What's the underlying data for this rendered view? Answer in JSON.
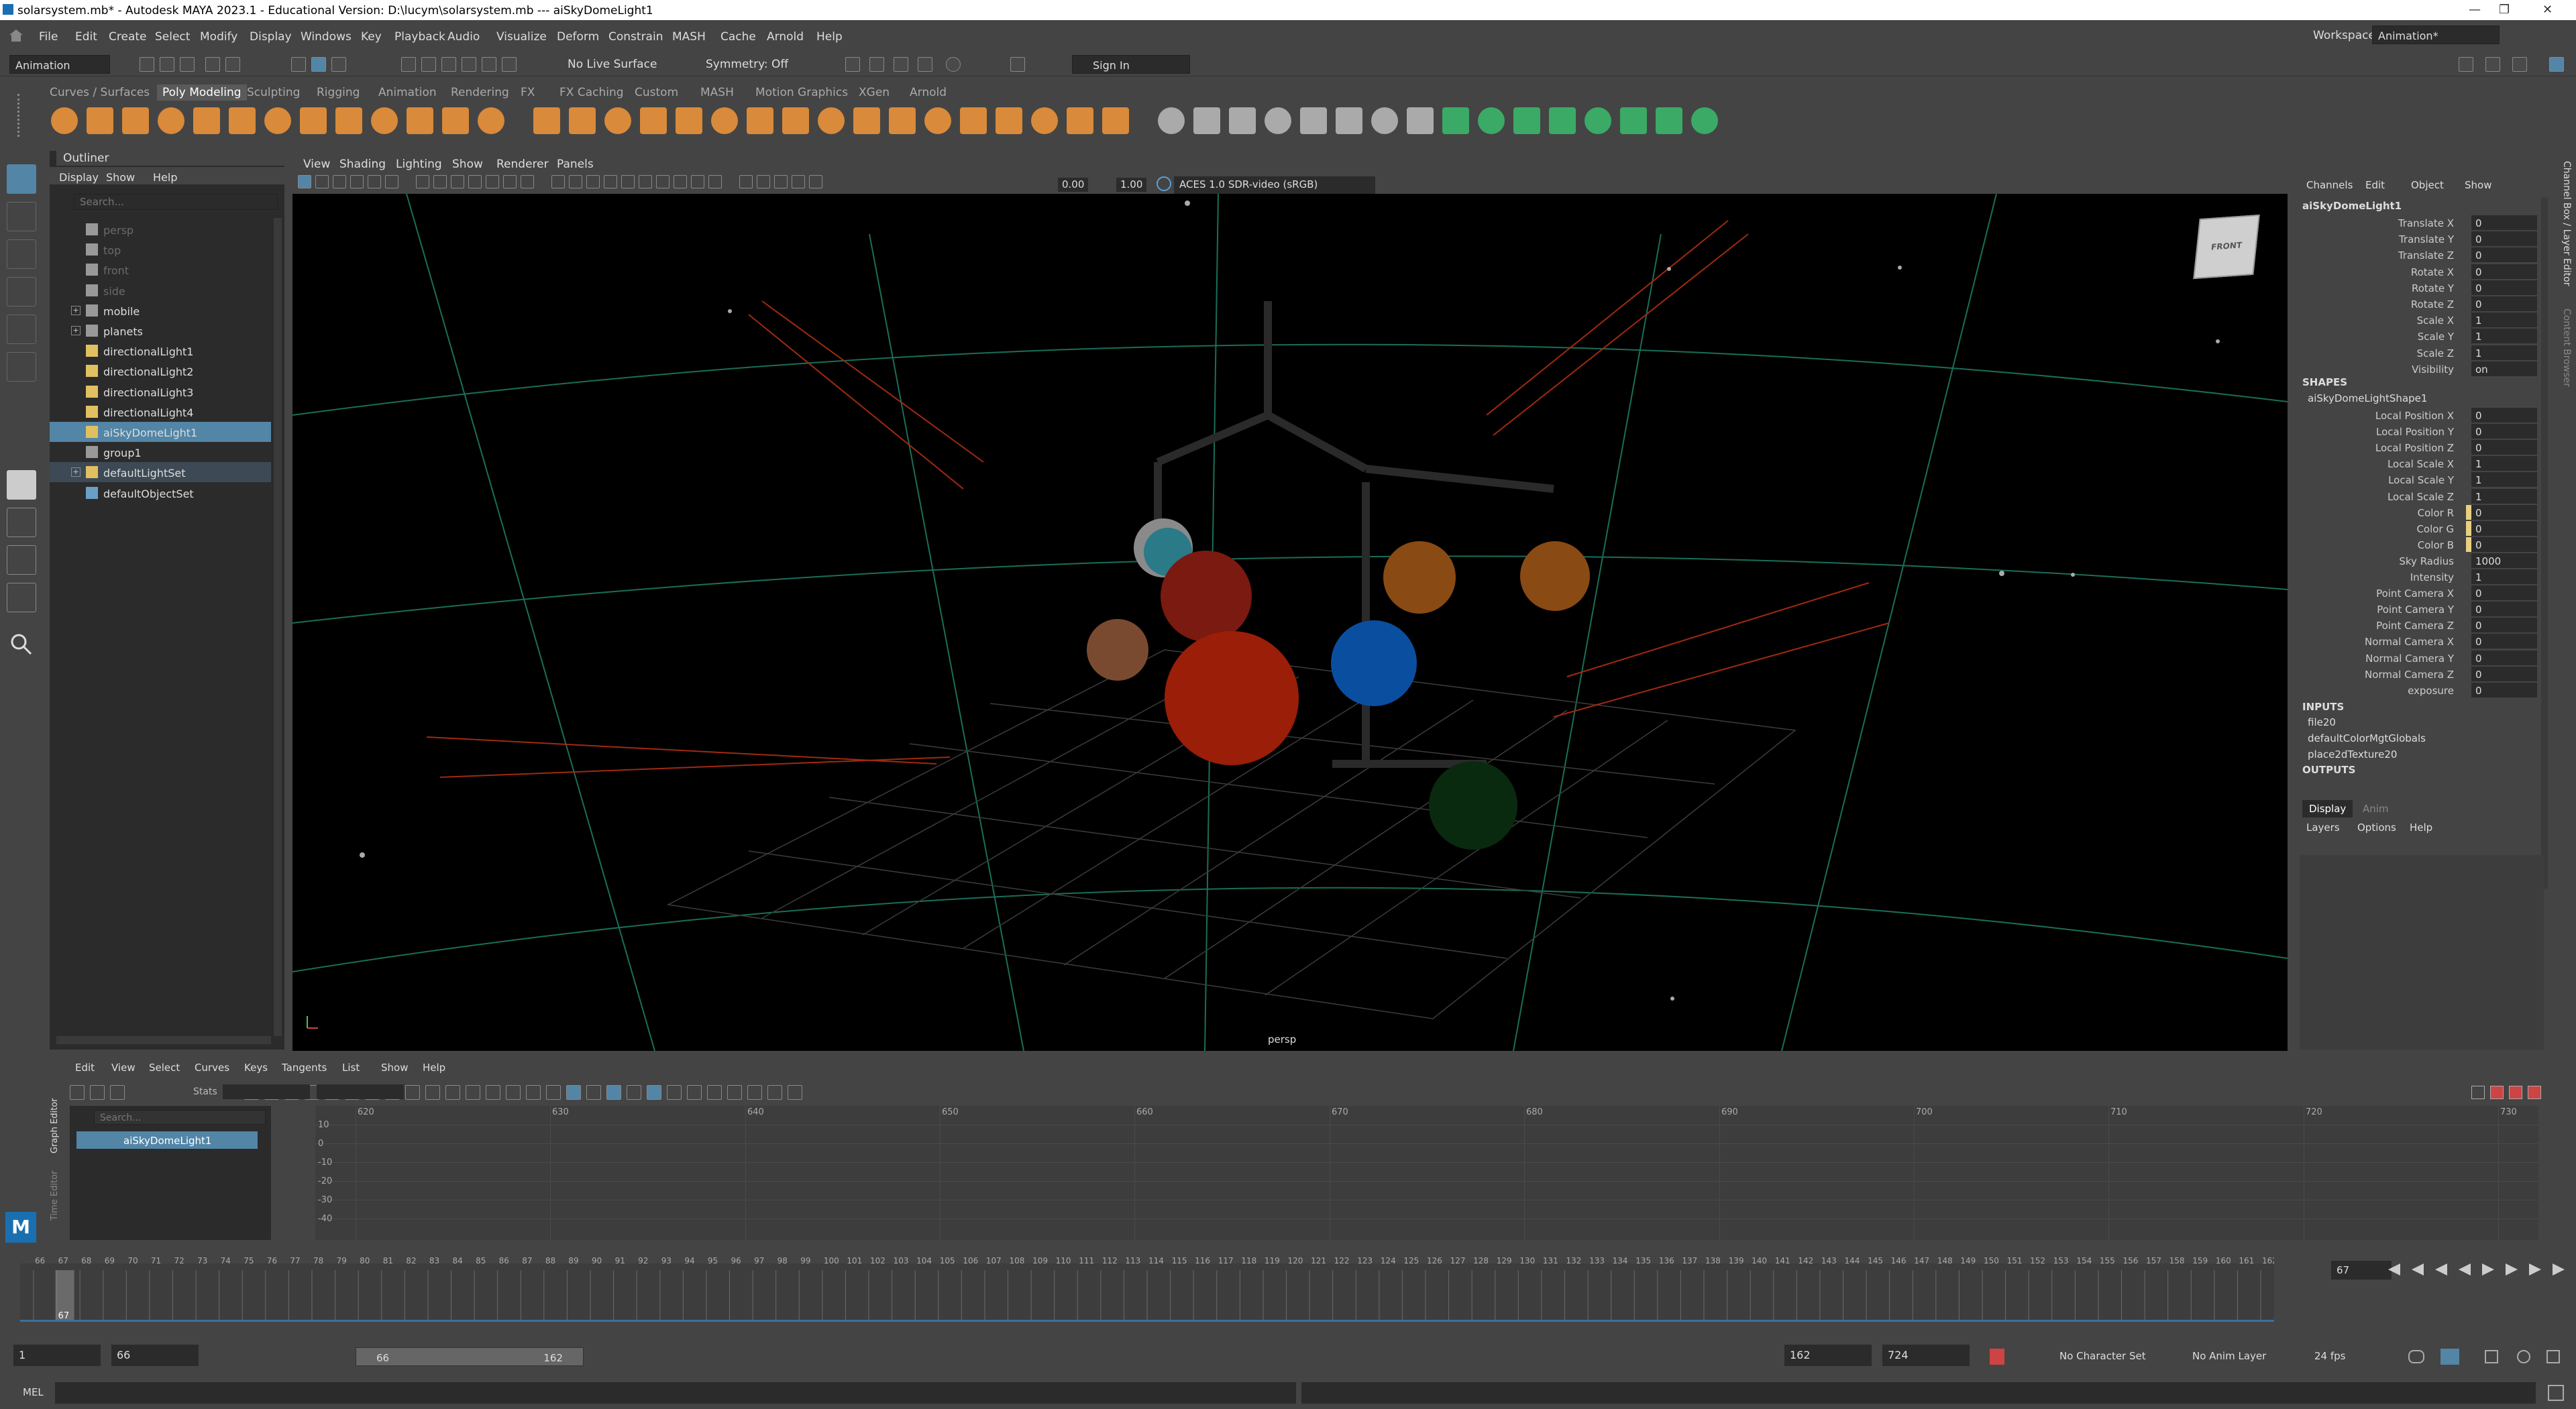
{
  "title_bar": {
    "text": "solarsystem.mb* - Autodesk MAYA 2023.1 - Educational Version: D:\\lucym\\solarsystem.mb  ---  aiSkyDomeLight1"
  },
  "menu": [
    "File",
    "Edit",
    "Create",
    "Select",
    "Modify",
    "Display",
    "Windows",
    "Key",
    "Playback",
    "Audio",
    "Visualize",
    "Deform",
    "Constrain",
    "MASH",
    "Cache",
    "Arnold",
    "Help"
  ],
  "workspace": {
    "label": "Workspace:",
    "value": "Animation*"
  },
  "status_line": {
    "menu_set": "Animation",
    "live_surface": "No Live Surface",
    "symmetry": "Symmetry: Off",
    "sign_in": "Sign In"
  },
  "shelf_tabs": [
    "Curves / Surfaces",
    "Poly Modeling",
    "Sculpting",
    "Rigging",
    "Animation",
    "Rendering",
    "FX",
    "FX Caching",
    "Custom",
    "MASH",
    "Motion Graphics",
    "XGen",
    "Arnold"
  ],
  "shelf_active": "Poly Modeling",
  "outliner": {
    "title": "Outliner",
    "menu": [
      "Display",
      "Show",
      "Help"
    ],
    "search_placeholder": "Search...",
    "items": [
      {
        "name": "persp",
        "state": "dim"
      },
      {
        "name": "top",
        "state": "dim"
      },
      {
        "name": "front",
        "state": "dim"
      },
      {
        "name": "side",
        "state": "dim"
      },
      {
        "name": "mobile",
        "state": "normal"
      },
      {
        "name": "planets",
        "state": "normal"
      },
      {
        "name": "directionalLight1",
        "state": "normal"
      },
      {
        "name": "directionalLight2",
        "state": "normal"
      },
      {
        "name": "directionalLight3",
        "state": "normal"
      },
      {
        "name": "directionalLight4",
        "state": "normal"
      },
      {
        "name": "aiSkyDomeLight1",
        "state": "selected"
      },
      {
        "name": "group1",
        "state": "normal"
      },
      {
        "name": "defaultLightSet",
        "state": "set"
      },
      {
        "name": "defaultObjectSet",
        "state": "normal"
      }
    ]
  },
  "viewport": {
    "menu": [
      "View",
      "Shading",
      "Lighting",
      "Show",
      "Renderer",
      "Panels"
    ],
    "exposure": "0.00",
    "gamma": "1.00",
    "color_space": "ACES 1.0 SDR-video (sRGB)",
    "camera_label": "persp",
    "cube_label": "FRONT"
  },
  "channel_box": {
    "menu": [
      "Channels",
      "Edit",
      "Object",
      "Show"
    ],
    "node": "aiSkyDomeLight1",
    "transform": [
      {
        "n": "Translate X",
        "v": "0"
      },
      {
        "n": "Translate Y",
        "v": "0"
      },
      {
        "n": "Translate Z",
        "v": "0"
      },
      {
        "n": "Rotate X",
        "v": "0"
      },
      {
        "n": "Rotate Y",
        "v": "0"
      },
      {
        "n": "Rotate Z",
        "v": "0"
      },
      {
        "n": "Scale X",
        "v": "1"
      },
      {
        "n": "Scale Y",
        "v": "1"
      },
      {
        "n": "Scale Z",
        "v": "1"
      },
      {
        "n": "Visibility",
        "v": "on"
      }
    ],
    "shapes_label": "SHAPES",
    "shape_node": "aiSkyDomeLightShape1",
    "shape_attrs": [
      {
        "n": "Local Position X",
        "v": "0"
      },
      {
        "n": "Local Position Y",
        "v": "0"
      },
      {
        "n": "Local Position Z",
        "v": "0"
      },
      {
        "n": "Local Scale X",
        "v": "1"
      },
      {
        "n": "Local Scale Y",
        "v": "1"
      },
      {
        "n": "Local Scale Z",
        "v": "1"
      },
      {
        "n": "Color R",
        "v": "0"
      },
      {
        "n": "Color G",
        "v": "0"
      },
      {
        "n": "Color B",
        "v": "0"
      },
      {
        "n": "Sky Radius",
        "v": "1000"
      },
      {
        "n": "Intensity",
        "v": "1"
      },
      {
        "n": "Point Camera X",
        "v": "0"
      },
      {
        "n": "Point Camera Y",
        "v": "0"
      },
      {
        "n": "Point Camera Z",
        "v": "0"
      },
      {
        "n": "Normal Camera X",
        "v": "0"
      },
      {
        "n": "Normal Camera Y",
        "v": "0"
      },
      {
        "n": "Normal Camera Z",
        "v": "0"
      },
      {
        "n": "exposure",
        "v": "0"
      }
    ],
    "inputs_label": "INPUTS",
    "inputs": [
      "file20",
      "defaultColorMgtGlobals",
      "place2dTexture20"
    ],
    "outputs_label": "OUTPUTS",
    "layer_tabs": [
      "Display",
      "Anim"
    ],
    "layer_menu": [
      "Layers",
      "Options",
      "Help"
    ],
    "side_tabs": [
      "Channel Box / Layer Editor",
      "Content Browser"
    ]
  },
  "graph_editor": {
    "menu": [
      "Edit",
      "View",
      "Select",
      "Curves",
      "Keys",
      "Tangents",
      "List",
      "Show",
      "Help"
    ],
    "stats_label": "Stats",
    "search_placeholder": "Search...",
    "item": "aiSkyDomeLight1",
    "x_ticks": [
      "620",
      "630",
      "640",
      "650",
      "660",
      "670",
      "680",
      "690",
      "700",
      "710",
      "720",
      "730"
    ],
    "y_ticks": [
      "10",
      "0",
      "-10",
      "-20",
      "-30",
      "-40"
    ],
    "side_labels": [
      "Graph Editor",
      "Time Editor"
    ]
  },
  "timeline": {
    "start": 66,
    "end": 162,
    "current": "67",
    "current_field": "67"
  },
  "range": {
    "start": "1",
    "anim_start": "66",
    "range_start": "66",
    "range_end": "162",
    "anim_end": "162",
    "end": "724",
    "character_set": "No Character Set",
    "anim_layer": "No Anim Layer",
    "fps": "24 fps"
  },
  "command_line": {
    "label": "MEL"
  }
}
